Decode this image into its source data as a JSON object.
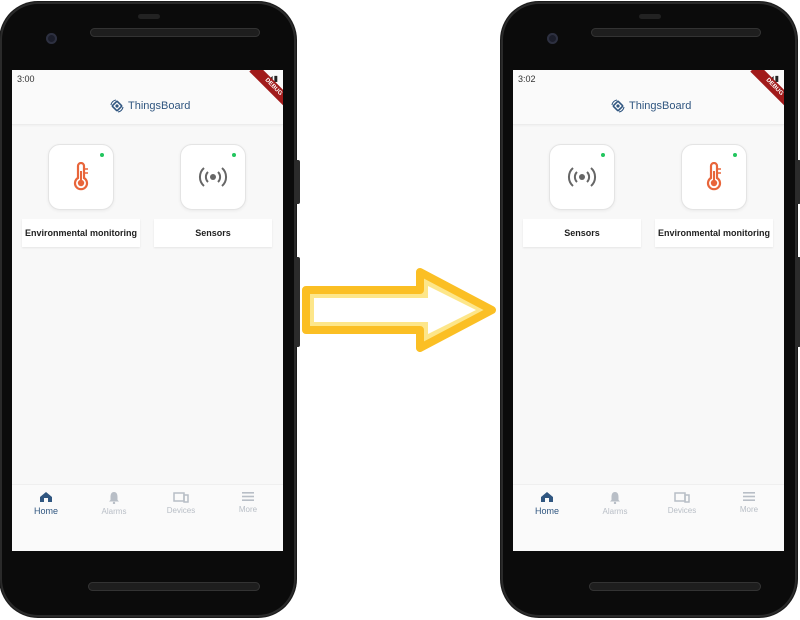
{
  "colors": {
    "accent": "#305680",
    "online": "#22c55e",
    "thermo": "#e8653a",
    "arrow_fill": "#fcd34d",
    "arrow_stroke": "#fbbf24"
  },
  "before": {
    "status_time": "3:00",
    "app_title": "ThingsBoard",
    "debug_label": "DEBUG",
    "cards": [
      {
        "label": "Environmental monitoring",
        "icon": "thermometer-icon",
        "online": true
      },
      {
        "label": "Sensors",
        "icon": "sensors-icon",
        "online": true
      }
    ],
    "nav": [
      {
        "label": "Home",
        "icon": "home-icon",
        "active": true
      },
      {
        "label": "Alarms",
        "icon": "bell-icon",
        "active": false
      },
      {
        "label": "Devices",
        "icon": "devices-icon",
        "active": false
      },
      {
        "label": "More",
        "icon": "menu-icon",
        "active": false
      }
    ]
  },
  "after": {
    "status_time": "3:02",
    "app_title": "ThingsBoard",
    "debug_label": "DEBUG",
    "cards": [
      {
        "label": "Sensors",
        "icon": "sensors-icon",
        "online": true
      },
      {
        "label": "Environmental monitoring",
        "icon": "thermometer-icon",
        "online": true
      }
    ],
    "nav": [
      {
        "label": "Home",
        "icon": "home-icon",
        "active": true
      },
      {
        "label": "Alarms",
        "icon": "bell-icon",
        "active": false
      },
      {
        "label": "Devices",
        "icon": "devices-icon",
        "active": false
      },
      {
        "label": "More",
        "icon": "menu-icon",
        "active": false
      }
    ]
  },
  "transition_icon": "arrow-right-icon"
}
